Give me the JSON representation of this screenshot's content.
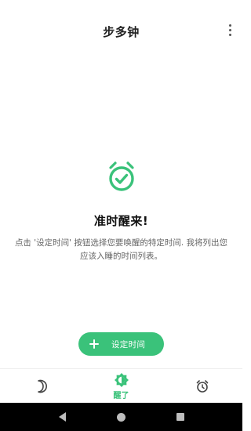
{
  "app_bar": {
    "title": "步多钟",
    "menu_icon": "more-vert-icon"
  },
  "empty_state": {
    "icon": "alarm-check-icon",
    "title": "准时醒来!",
    "description": "点击 '设定时间' 按钮选择您要唤醒的特定时间. 我将列出您应该入睡的时间列表。"
  },
  "action_button": {
    "icon": "plus-icon",
    "label": "设定时间"
  },
  "bottom_nav": {
    "items": [
      {
        "icon": "moon-icon",
        "label": "",
        "active": false
      },
      {
        "icon": "sun-icon",
        "label": "醒了",
        "active": true
      },
      {
        "icon": "alarm-clock-icon",
        "label": "",
        "active": false
      }
    ]
  },
  "system_nav": {
    "back_icon": "back-icon",
    "home_icon": "home-icon",
    "recents_icon": "recents-icon"
  },
  "colors": {
    "accent": "#3ac27a",
    "background": "#ffffff",
    "system_bar": "#000000"
  }
}
